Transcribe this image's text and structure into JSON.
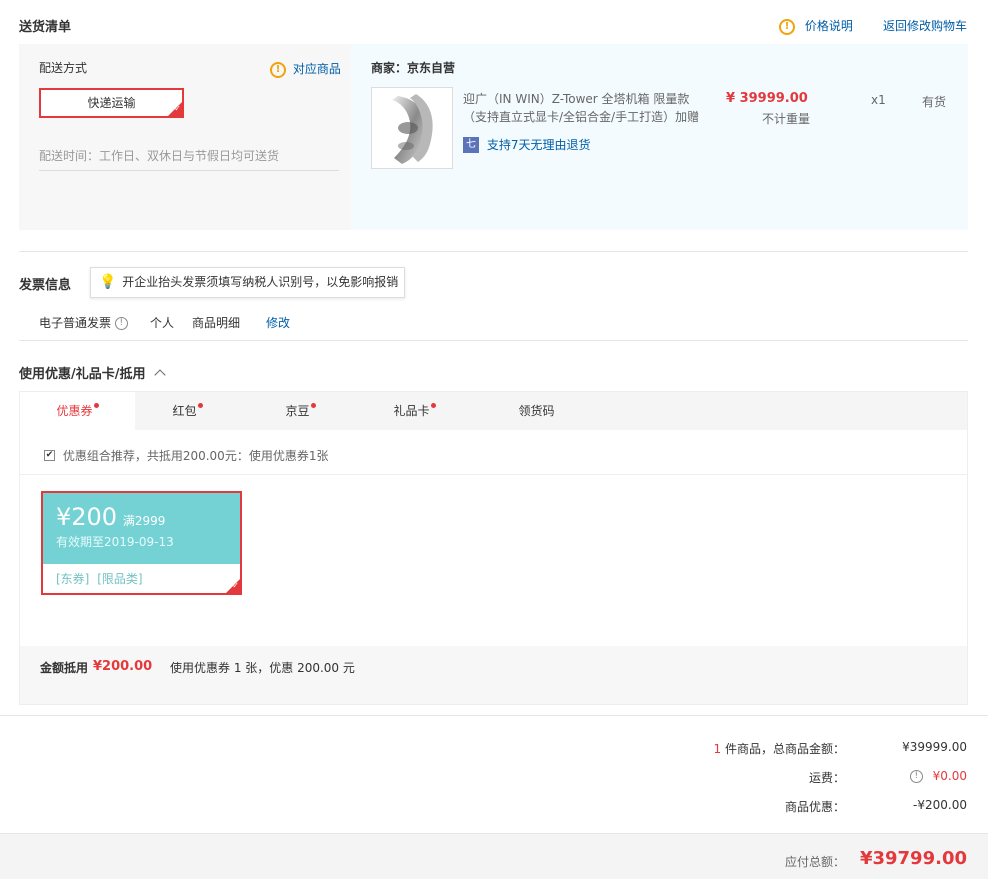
{
  "delivery_list": {
    "title": "送货清单",
    "price_note": "价格说明",
    "back_to_cart": "返回修改购物车"
  },
  "shipping": {
    "method_label": "配送方式",
    "related_goods": "对应商品",
    "method_value": "快递运输",
    "time_text": "配送时间：工作日、双休日与节假日均可送货"
  },
  "merchant": {
    "label": "商家：京东自营",
    "product": {
      "name_line1": "迎广（IN WIN）Z-Tower 全塔机箱 限量款",
      "name_line2": "（支持直立式显卡/全铝合金/手工打造）加赠",
      "price": "¥ 39999.00",
      "weight": "不计重量",
      "qty": "x1",
      "stock": "有货",
      "return_badge": "七",
      "return_text": "支持7天无理由退货"
    }
  },
  "invoice": {
    "title": "发票信息",
    "tip": "开企业抬头发票须填写纳税人识别号，以免影响报销",
    "type": "电子普通发票",
    "holder": "个人",
    "content": "商品明细",
    "edit": "修改"
  },
  "coupons": {
    "title": "使用优惠/礼品卡/抵用",
    "tabs": [
      "优惠券",
      "红包",
      "京豆",
      "礼品卡",
      "领货码"
    ],
    "combo_text": "优惠组合推荐，共抵用200.00元：使用优惠券1张",
    "coupon": {
      "amount": "¥200",
      "condition": "满2999",
      "valid": "有效期至2019-09-13",
      "tag1": "[东券]",
      "tag2": "[限品类]"
    },
    "summary_label": "金额抵用",
    "summary_amount": "¥200.00",
    "summary_text": "使用优惠券 1 张，优惠 200.00 元"
  },
  "totals": {
    "count": "1",
    "count_suffix": " 件商品，总商品金额：",
    "goods_amount": "¥39999.00",
    "freight_label": "运费：",
    "freight_amount": "¥0.00",
    "discount_label": "商品优惠：",
    "discount_amount": "-¥200.00",
    "payable_label": "应付总额：",
    "payable_amount": "¥39799.00"
  },
  "colors": {
    "accent_red": "#e4393c",
    "link_blue": "#005ea7",
    "coupon_teal": "#74d2d4",
    "panel_blue": "#f3fbfe",
    "panel_grey": "#f7f7f7"
  }
}
